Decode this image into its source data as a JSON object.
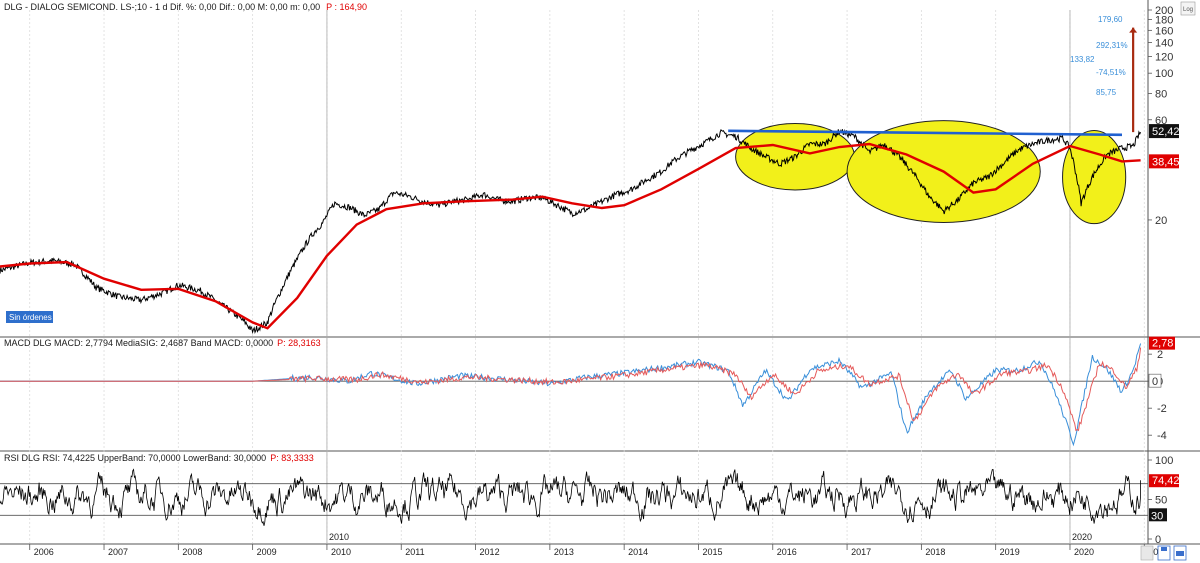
{
  "chart_data": {
    "type": "line",
    "header": {
      "main": "DLG - DIALOG SEMICOND.  LS-;10 -  1 d Dif. %: 0,00 Dif.: 0,00 M: 0,00 m: 0,00",
      "price": "P : 164,90"
    },
    "price_panel": {
      "scale": "log",
      "scale_badge": "Log",
      "y_ticks": [
        "200",
        "180",
        "160",
        "140",
        "120",
        "100",
        "80",
        "60",
        "20"
      ],
      "last_value_label": "52,42",
      "ma_value_label": "38,45",
      "sin_ordenes_label": "Sin órdenes",
      "resistance_level": 52,
      "resistance_from_year": 2015.4,
      "annotations": [
        "179,60",
        "292,31%",
        "133,82",
        "-74,51%",
        "85,75"
      ],
      "arrow": {
        "from": 52.42,
        "to": 164.9,
        "year": 2020.85
      },
      "ellipses_years": [
        [
          2015.5,
          2017.1
        ],
        [
          2017.0,
          2019.6
        ],
        [
          2019.9,
          2020.75
        ]
      ],
      "series": [
        {
          "name": "DLG",
          "color": "#000000",
          "points": [
            [
              2005.6,
              11.5
            ],
            [
              2006.0,
              12.5
            ],
            [
              2006.3,
              12.8
            ],
            [
              2006.6,
              12.3
            ],
            [
              2006.9,
              9.5
            ],
            [
              2007.2,
              8.6
            ],
            [
              2007.5,
              8.3
            ],
            [
              2007.8,
              9.0
            ],
            [
              2008.0,
              9.8
            ],
            [
              2008.3,
              9.2
            ],
            [
              2008.6,
              7.8
            ],
            [
              2008.9,
              6.5
            ],
            [
              2009.0,
              5.9
            ],
            [
              2009.2,
              6.5
            ],
            [
              2009.4,
              9.5
            ],
            [
              2009.6,
              13.0
            ],
            [
              2009.8,
              17.0
            ],
            [
              2009.95,
              19.5
            ],
            [
              2010.1,
              24.0
            ],
            [
              2010.3,
              23.0
            ],
            [
              2010.5,
              21.0
            ],
            [
              2010.7,
              22.5
            ],
            [
              2010.9,
              27.0
            ],
            [
              2011.1,
              26.0
            ],
            [
              2011.3,
              24.5
            ],
            [
              2011.5,
              23.5
            ],
            [
              2011.7,
              24.5
            ],
            [
              2011.9,
              25.0
            ],
            [
              2012.1,
              26.5
            ],
            [
              2012.3,
              25.0
            ],
            [
              2012.5,
              24.5
            ],
            [
              2012.7,
              25.5
            ],
            [
              2012.9,
              25.5
            ],
            [
              2013.1,
              23.5
            ],
            [
              2013.3,
              21.5
            ],
            [
              2013.5,
              22.5
            ],
            [
              2013.7,
              24.5
            ],
            [
              2013.9,
              26.5
            ],
            [
              2014.1,
              28.0
            ],
            [
              2014.3,
              31.0
            ],
            [
              2014.5,
              34.0
            ],
            [
              2014.7,
              39.0
            ],
            [
              2014.9,
              43.0
            ],
            [
              2015.1,
              47.0
            ],
            [
              2015.3,
              52.0
            ],
            [
              2015.5,
              50.0
            ],
            [
              2015.7,
              44.0
            ],
            [
              2015.9,
              40.0
            ],
            [
              2016.1,
              37.0
            ],
            [
              2016.3,
              40.0
            ],
            [
              2016.5,
              46.0
            ],
            [
              2016.7,
              46.0
            ],
            [
              2016.9,
              53.0
            ],
            [
              2017.1,
              50.0
            ],
            [
              2017.3,
              42.0
            ],
            [
              2017.5,
              46.0
            ],
            [
              2017.7,
              40.0
            ],
            [
              2017.9,
              33.0
            ],
            [
              2018.1,
              26.0
            ],
            [
              2018.3,
              22.0
            ],
            [
              2018.5,
              25.0
            ],
            [
              2018.7,
              30.0
            ],
            [
              2018.9,
              32.0
            ],
            [
              2019.1,
              37.0
            ],
            [
              2019.3,
              43.0
            ],
            [
              2019.5,
              46.0
            ],
            [
              2019.7,
              48.0
            ],
            [
              2019.9,
              49.0
            ],
            [
              2020.0,
              44.0
            ],
            [
              2020.15,
              24.0
            ],
            [
              2020.3,
              32.0
            ],
            [
              2020.5,
              41.0
            ],
            [
              2020.7,
              44.0
            ],
            [
              2020.85,
              45.0
            ],
            [
              2020.95,
              52.42
            ]
          ]
        },
        {
          "name": "MA",
          "color": "#e00000",
          "points": [
            [
              2005.6,
              12.0
            ],
            [
              2006.0,
              12.4
            ],
            [
              2006.5,
              12.6
            ],
            [
              2007.0,
              10.5
            ],
            [
              2007.5,
              9.3
            ],
            [
              2008.0,
              9.4
            ],
            [
              2008.5,
              8.2
            ],
            [
              2009.0,
              6.5
            ],
            [
              2009.2,
              6.1
            ],
            [
              2009.6,
              8.5
            ],
            [
              2010.0,
              13.5
            ],
            [
              2010.4,
              19.0
            ],
            [
              2010.8,
              22.5
            ],
            [
              2011.3,
              24.0
            ],
            [
              2011.8,
              24.5
            ],
            [
              2012.5,
              25.0
            ],
            [
              2012.9,
              25.8
            ],
            [
              2013.3,
              24.0
            ],
            [
              2013.7,
              22.8
            ],
            [
              2014.0,
              23.5
            ],
            [
              2014.5,
              28.0
            ],
            [
              2015.0,
              35.0
            ],
            [
              2015.5,
              44.0
            ],
            [
              2016.0,
              45.5
            ],
            [
              2016.5,
              41.5
            ],
            [
              2016.9,
              44.5
            ],
            [
              2017.3,
              46.0
            ],
            [
              2017.8,
              41.0
            ],
            [
              2018.3,
              34.0
            ],
            [
              2018.7,
              27.0
            ],
            [
              2019.0,
              28.0
            ],
            [
              2019.5,
              37.0
            ],
            [
              2020.0,
              45.0
            ],
            [
              2020.4,
              41.0
            ],
            [
              2020.7,
              38.0
            ],
            [
              2020.95,
              38.45
            ]
          ]
        }
      ]
    },
    "macd_panel": {
      "title": "MACD DLG MACD: 2,7794 MediaSIG: 2,4687 Band MACD: 0,0000",
      "price": "P: 28,3163",
      "y_ticks": [
        "2",
        "0",
        "-2",
        "-4"
      ],
      "ylim": [
        -4.8,
        2.9
      ],
      "last_value_label": "2,78",
      "zero_label": "0",
      "series": [
        {
          "name": "MACD",
          "color": "#3a8fd9",
          "points": [
            [
              2005.6,
              0.0
            ],
            [
              2009.0,
              0.0
            ],
            [
              2009.8,
              0.3
            ],
            [
              2010.3,
              0.0
            ],
            [
              2010.6,
              0.6
            ],
            [
              2011.2,
              -0.2
            ],
            [
              2011.8,
              0.4
            ],
            [
              2012.5,
              0.1
            ],
            [
              2013.0,
              -0.2
            ],
            [
              2013.5,
              0.3
            ],
            [
              2014.0,
              0.6
            ],
            [
              2014.5,
              1.0
            ],
            [
              2015.0,
              1.4
            ],
            [
              2015.4,
              0.8
            ],
            [
              2015.6,
              -1.8
            ],
            [
              2015.9,
              0.8
            ],
            [
              2016.2,
              -1.5
            ],
            [
              2016.5,
              0.9
            ],
            [
              2016.9,
              1.5
            ],
            [
              2017.2,
              -0.5
            ],
            [
              2017.6,
              0.6
            ],
            [
              2017.8,
              -3.8
            ],
            [
              2018.1,
              -0.8
            ],
            [
              2018.4,
              0.8
            ],
            [
              2018.6,
              -1.3
            ],
            [
              2019.0,
              0.8
            ],
            [
              2019.3,
              0.8
            ],
            [
              2019.6,
              1.5
            ],
            [
              2019.8,
              -0.8
            ],
            [
              2020.05,
              -4.6
            ],
            [
              2020.3,
              1.8
            ],
            [
              2020.5,
              0.9
            ],
            [
              2020.7,
              -0.8
            ],
            [
              2020.85,
              0.8
            ],
            [
              2020.95,
              2.78
            ]
          ]
        },
        {
          "name": "MediaSIG",
          "color": "#e55a5a",
          "points": [
            [
              2005.6,
              0.0
            ],
            [
              2009.0,
              0.0
            ],
            [
              2009.8,
              0.2
            ],
            [
              2010.4,
              0.1
            ],
            [
              2010.7,
              0.5
            ],
            [
              2011.3,
              -0.1
            ],
            [
              2011.9,
              0.3
            ],
            [
              2012.5,
              0.1
            ],
            [
              2013.1,
              -0.1
            ],
            [
              2013.6,
              0.2
            ],
            [
              2014.1,
              0.5
            ],
            [
              2014.6,
              0.9
            ],
            [
              2015.1,
              1.2
            ],
            [
              2015.5,
              0.5
            ],
            [
              2015.7,
              -1.2
            ],
            [
              2016.0,
              0.5
            ],
            [
              2016.3,
              -1.0
            ],
            [
              2016.6,
              0.7
            ],
            [
              2017.0,
              1.2
            ],
            [
              2017.3,
              -0.2
            ],
            [
              2017.7,
              0.4
            ],
            [
              2017.9,
              -3.0
            ],
            [
              2018.2,
              -0.5
            ],
            [
              2018.5,
              0.6
            ],
            [
              2018.7,
              -1.0
            ],
            [
              2019.1,
              0.6
            ],
            [
              2019.4,
              0.7
            ],
            [
              2019.7,
              1.2
            ],
            [
              2019.9,
              -0.5
            ],
            [
              2020.1,
              -3.8
            ],
            [
              2020.4,
              1.4
            ],
            [
              2020.6,
              0.7
            ],
            [
              2020.75,
              -0.5
            ],
            [
              2020.9,
              0.9
            ],
            [
              2020.95,
              2.47
            ]
          ]
        }
      ]
    },
    "rsi_panel": {
      "title": "RSI DLG RSI: 74,4225 UpperBand: 70,0000 LowerBand: 30,0000",
      "price": "P: 83,3333",
      "y_ticks": [
        "100",
        "50",
        "0"
      ],
      "band_labels": [
        "30"
      ],
      "ylim": [
        0,
        100
      ],
      "upper_band": 70,
      "lower_band": 30,
      "last_value_label": "74,42"
    },
    "x_axis": {
      "years": [
        "2006",
        "2007",
        "2008",
        "2009",
        "2010",
        "2011",
        "2012",
        "2013",
        "2014",
        "2015",
        "2016",
        "2017",
        "2018",
        "2019",
        "2020",
        "2021"
      ],
      "panel_year_labels": [
        "2010",
        "2020"
      ]
    }
  }
}
